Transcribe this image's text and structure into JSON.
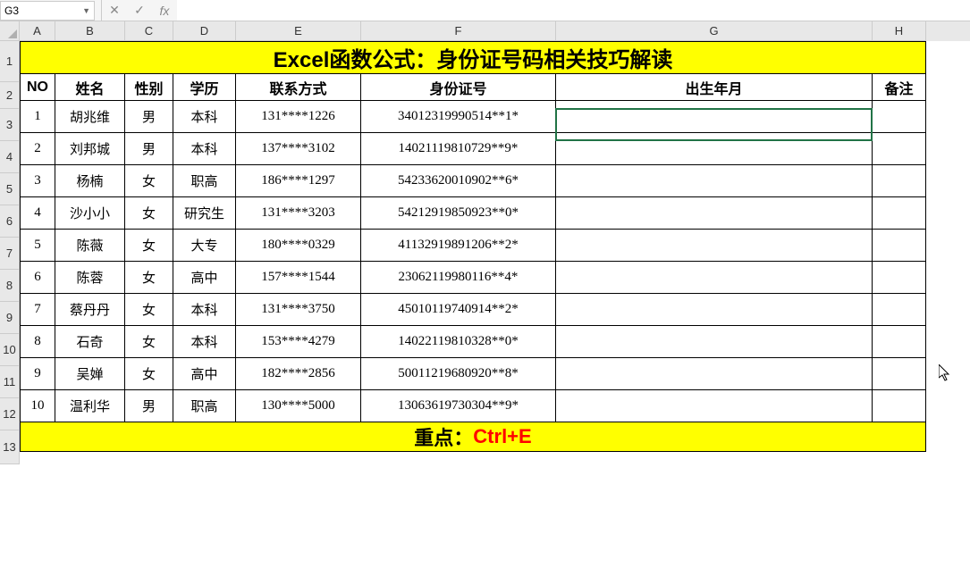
{
  "formula_bar": {
    "name_box": "G3",
    "cancel": "✕",
    "confirm": "✓",
    "fx": "fx",
    "formula": ""
  },
  "columns": [
    "A",
    "B",
    "C",
    "D",
    "E",
    "F",
    "G",
    "H"
  ],
  "rows": [
    "1",
    "2",
    "3",
    "4",
    "5",
    "6",
    "7",
    "8",
    "9",
    "10",
    "11",
    "12",
    "13"
  ],
  "title": "Excel函数公式：身份证号码相关技巧解读",
  "headers": {
    "no": "NO",
    "name": "姓名",
    "gender": "性别",
    "edu": "学历",
    "contact": "联系方式",
    "id": "身份证号",
    "dob": "出生年月",
    "remark": "备注"
  },
  "data": [
    {
      "no": "1",
      "name": "胡兆维",
      "gender": "男",
      "edu": "本科",
      "contact": "131****1226",
      "id": "34012319990514**1*",
      "dob": "",
      "remark": ""
    },
    {
      "no": "2",
      "name": "刘邦城",
      "gender": "男",
      "edu": "本科",
      "contact": "137****3102",
      "id": "14021119810729**9*",
      "dob": "",
      "remark": ""
    },
    {
      "no": "3",
      "name": "杨楠",
      "gender": "女",
      "edu": "职高",
      "contact": "186****1297",
      "id": "54233620010902**6*",
      "dob": "",
      "remark": ""
    },
    {
      "no": "4",
      "name": "沙小小",
      "gender": "女",
      "edu": "研究生",
      "contact": "131****3203",
      "id": "54212919850923**0*",
      "dob": "",
      "remark": ""
    },
    {
      "no": "5",
      "name": "陈薇",
      "gender": "女",
      "edu": "大专",
      "contact": "180****0329",
      "id": "41132919891206**2*",
      "dob": "",
      "remark": ""
    },
    {
      "no": "6",
      "name": "陈蓉",
      "gender": "女",
      "edu": "高中",
      "contact": "157****1544",
      "id": "23062119980116**4*",
      "dob": "",
      "remark": ""
    },
    {
      "no": "7",
      "name": "蔡丹丹",
      "gender": "女",
      "edu": "本科",
      "contact": "131****3750",
      "id": "45010119740914**2*",
      "dob": "",
      "remark": ""
    },
    {
      "no": "8",
      "name": "石奇",
      "gender": "女",
      "edu": "本科",
      "contact": "153****4279",
      "id": "14022119810328**0*",
      "dob": "",
      "remark": ""
    },
    {
      "no": "9",
      "name": "吴婵",
      "gender": "女",
      "edu": "高中",
      "contact": "182****2856",
      "id": "50011219680920**8*",
      "dob": "",
      "remark": ""
    },
    {
      "no": "10",
      "name": "温利华",
      "gender": "男",
      "edu": "职高",
      "contact": "130****5000",
      "id": "13063619730304**9*",
      "dob": "",
      "remark": ""
    }
  ],
  "footer": {
    "label": "重点：",
    "key": "Ctrl+E"
  },
  "active_cell": "G3"
}
